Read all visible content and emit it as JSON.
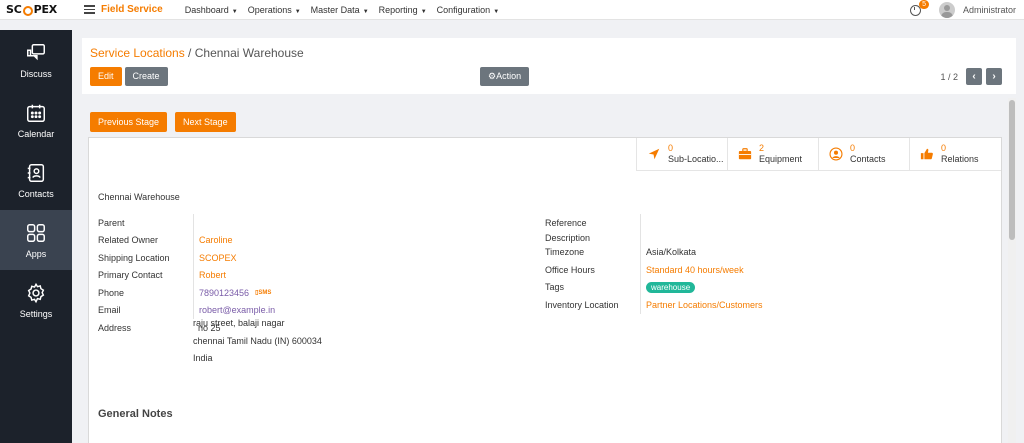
{
  "brand": {
    "logo": "SCOPEX",
    "app_name": "Field Service"
  },
  "topmenu": [
    {
      "label": "Dashboard"
    },
    {
      "label": "Operations"
    },
    {
      "label": "Master Data"
    },
    {
      "label": "Reporting"
    },
    {
      "label": "Configuration"
    }
  ],
  "user": {
    "name": "Administrator",
    "notification_count": "5"
  },
  "sidebar": {
    "items": [
      {
        "label": "Discuss",
        "icon": "chat-icon"
      },
      {
        "label": "Calendar",
        "icon": "calendar-icon"
      },
      {
        "label": "Contacts",
        "icon": "contacts-icon"
      },
      {
        "label": "Apps",
        "icon": "apps-icon"
      },
      {
        "label": "Settings",
        "icon": "gear-icon"
      }
    ]
  },
  "breadcrumb": {
    "parent": "Service Locations",
    "separator": " / ",
    "current": "Chennai Warehouse"
  },
  "toolbar": {
    "edit": "Edit",
    "create": "Create",
    "action": "Action"
  },
  "pager": {
    "value": "1 / 2"
  },
  "stages": {
    "previous": "Previous Stage",
    "next": "Next Stage"
  },
  "smart_buttons": [
    {
      "value": "0",
      "label": "Sub-Locatio...",
      "icon": "location-arrow-icon"
    },
    {
      "value": "2",
      "label": "Equipment",
      "icon": "briefcase-icon"
    },
    {
      "value": "0",
      "label": "Contacts",
      "icon": "user-circle-icon"
    },
    {
      "value": "0",
      "label": "Relations",
      "icon": "thumbs-up-icon"
    }
  ],
  "record": {
    "name": "Chennai Warehouse",
    "left_fields": [
      {
        "label": "Parent",
        "value": ""
      },
      {
        "label": "Related Owner",
        "value": "Caroline"
      },
      {
        "label": "Shipping Location",
        "value": "SCOPEX"
      },
      {
        "label": "Primary Contact",
        "value": "Robert"
      },
      {
        "label": "Phone",
        "value": "7890123456",
        "sms": "SMS"
      },
      {
        "label": "Email",
        "value": "robert@example.in"
      },
      {
        "label": "Address",
        "value": "no 25"
      }
    ],
    "address_lines": [
      "raju street, balaji nagar",
      "chennai   Tamil Nadu (IN)   600034",
      "India"
    ],
    "right_fields": [
      {
        "label": "Reference",
        "value": ""
      },
      {
        "label": "Description",
        "value": ""
      },
      {
        "label": "Timezone",
        "value": "Asia/Kolkata"
      },
      {
        "label": "Office Hours",
        "value": "Standard 40 hours/week"
      },
      {
        "label": "Tags",
        "value": "warehouse"
      },
      {
        "label": "Inventory Location",
        "value": "Partner Locations/Customers"
      }
    ],
    "notes_title": "General Notes"
  },
  "colors": {
    "accent": "#f57c00",
    "sidebar": "#1c222b",
    "tag": "#21b799"
  }
}
